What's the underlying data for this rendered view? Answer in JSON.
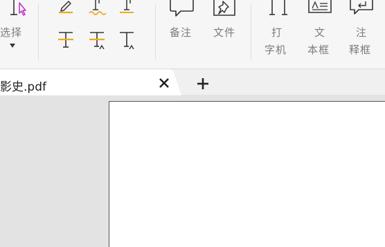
{
  "ribbon": {
    "select": {
      "label": "选择"
    },
    "comment_note": {
      "label": "备注"
    },
    "file_attachment": {
      "label": "文件"
    },
    "typewriter": {
      "line1": "打",
      "line2": "字机"
    },
    "textbox": {
      "line1": "文",
      "line2": "本框"
    },
    "callout": {
      "line1": "注",
      "line2": "释框"
    }
  },
  "tabs": [
    {
      "title": "影史.pdf"
    }
  ],
  "colors": {
    "accent": "#f0a81c",
    "select_cursor": "#c030c8"
  },
  "icons": [
    "select-text-cursor-icon",
    "dropdown-arrow-icon",
    "highlight-pen-icon",
    "squiggly-underline-icon",
    "underline-text-icon",
    "strikeout-icon",
    "replace-text-icon",
    "insert-text-icon",
    "note-bubble-icon",
    "pushpin-attach-icon",
    "typewriter-icon",
    "textbox-icon",
    "callout-icon",
    "close-icon",
    "plus-icon"
  ]
}
